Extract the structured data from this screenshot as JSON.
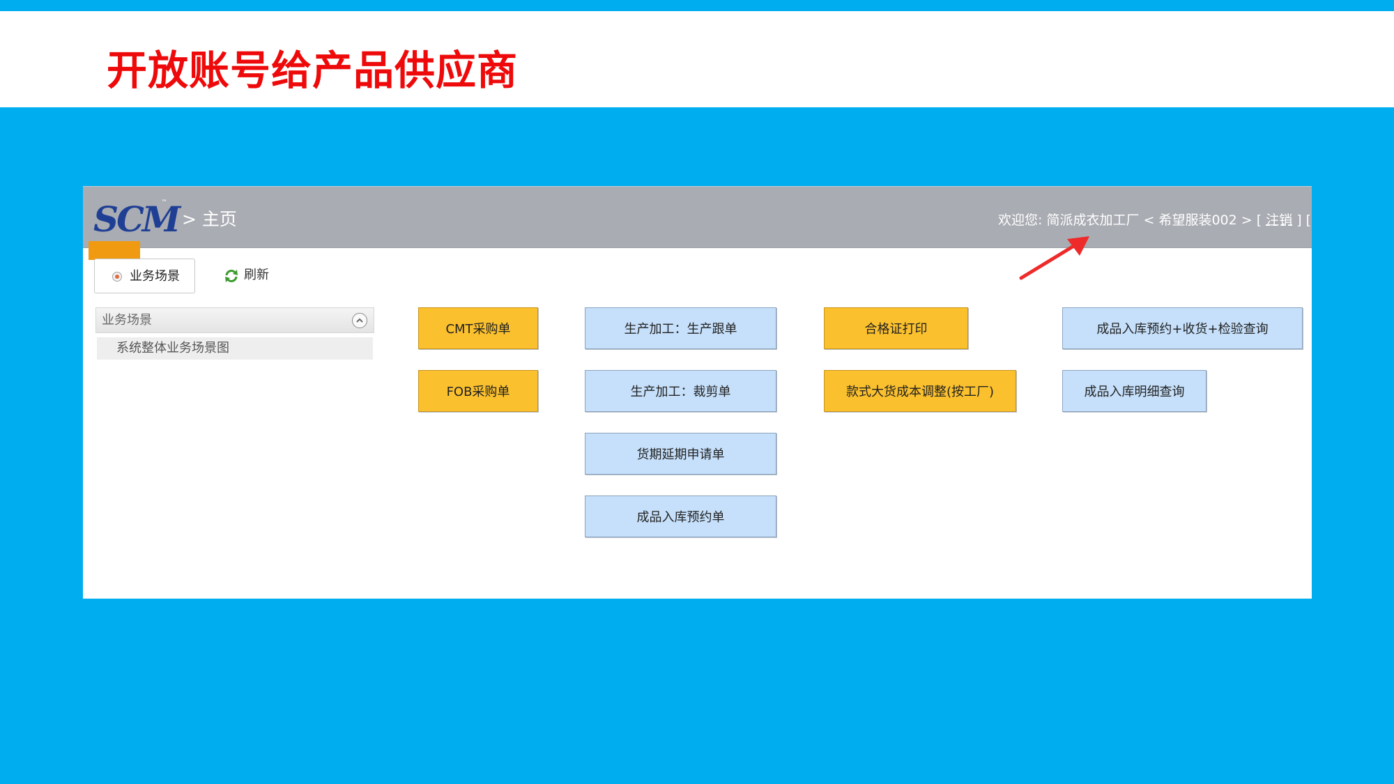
{
  "slide": {
    "title": "开放账号给产品供应商"
  },
  "app": {
    "logo": {
      "text": "SCM",
      "tm": "™"
    },
    "breadcrumb": "> 主页",
    "welcome": {
      "prefix": "欢迎您: 简派成衣加工厂 < 希望服装002 > [ ",
      "logout": "注销",
      "suffix": " ] [ 更"
    },
    "toolbar": {
      "scene_tab": "业务场景",
      "refresh": "刷新"
    },
    "sidebar": {
      "header": "业务场景",
      "items": [
        {
          "label": "系统整体业务场景图"
        }
      ]
    },
    "buttons": {
      "cmt_purchase": "CMT采购单",
      "fob_purchase": "FOB采购单",
      "production_tracking": "生产加工：生产跟单",
      "production_cutting": "生产加工：裁剪单",
      "delivery_extension": "货期延期申请单",
      "finished_reservation": "成品入库预约单",
      "certificate_print": "合格证打印",
      "style_cost_adjust": "款式大货成本调整(按工厂)",
      "reservation_receiving_inspection": "成品入库预约+收货+检验查询",
      "warehouse_detail_query": "成品入库明细查询"
    },
    "colors": {
      "orange": "#fbc02d",
      "blue": "#c6e0fb",
      "header": "#a9acb3",
      "title_red": "#ee0a0a",
      "frame_blue": "#00adee"
    }
  }
}
